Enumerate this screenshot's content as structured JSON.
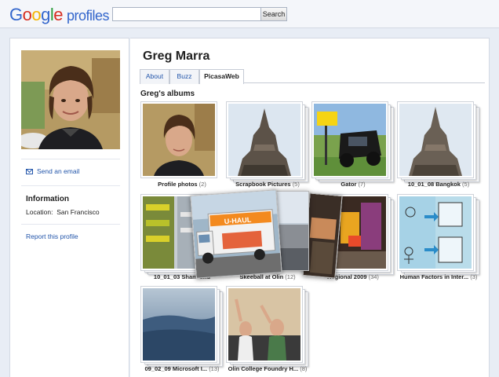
{
  "header": {
    "logo_letters": [
      "G",
      "o",
      "o",
      "g",
      "l",
      "e"
    ],
    "logo_word": "profiles",
    "search_placeholder": "",
    "search_button": "Search"
  },
  "profile": {
    "name": "Greg Marra",
    "send_email": "Send an email",
    "information_heading": "Information",
    "location_label": "Location:",
    "location_value": "San Francisco",
    "report": "Report this profile"
  },
  "tabs": [
    {
      "label": "About",
      "active": false
    },
    {
      "label": "Buzz",
      "active": false
    },
    {
      "label": "PicasaWeb",
      "active": true
    }
  ],
  "albums_heading": "Greg's albums",
  "albums": [
    {
      "title": "Profile photos",
      "count": "(2)"
    },
    {
      "title": "Scrapbook Pictures",
      "count": "(5)"
    },
    {
      "title": "Gator",
      "count": "(7)"
    },
    {
      "title": "10_01_08 Bangkok",
      "count": "(5)"
    },
    {
      "title": "10_01_03 Sham Shu",
      "count": ""
    },
    {
      "title": "Skeeball at Olin",
      "count": "(12)"
    },
    {
      "title": "Regional 2009",
      "count": "(34)"
    },
    {
      "title": "Human Factors in Inter...",
      "count": "(3)"
    },
    {
      "title": "09_02_09 Microsoft I...",
      "count": "(13)"
    },
    {
      "title": "Olin College Foundry H...",
      "count": "(8)"
    }
  ],
  "overlay": {
    "truck_text": "U-HAUL"
  },
  "colors": {
    "link": "#2255aa",
    "page_bg": "#e8edf5",
    "panel_border": "#d3d9e3"
  }
}
